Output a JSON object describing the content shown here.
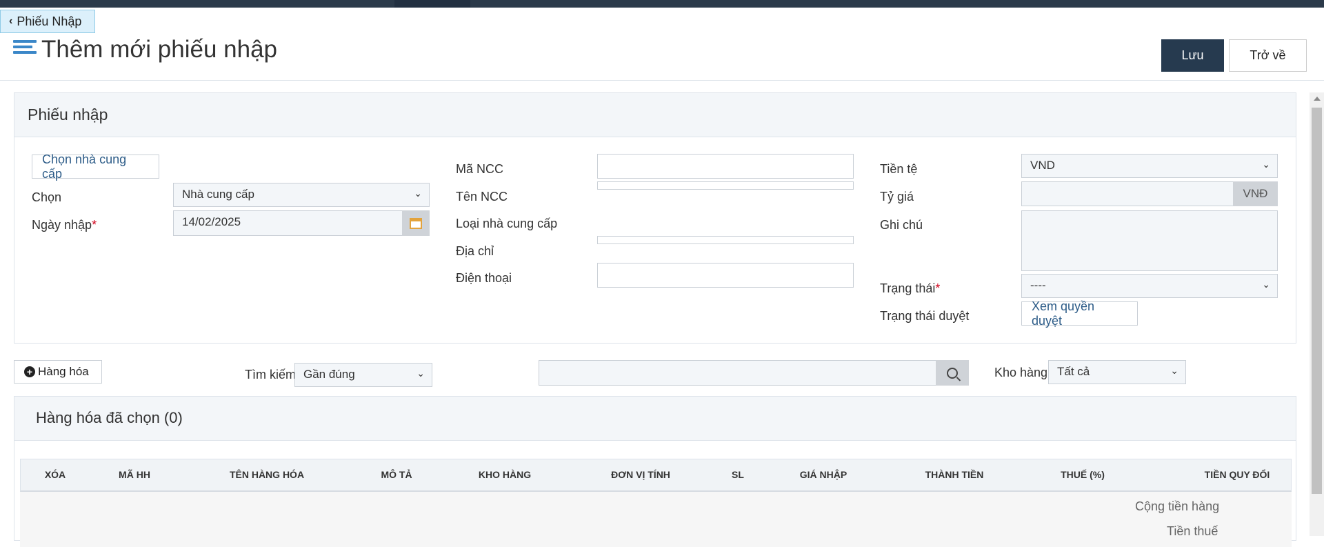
{
  "back_link": {
    "chevron": "‹",
    "label": "Phiếu Nhập"
  },
  "page_title": "Thêm mới phiếu nhập",
  "actions": {
    "save_label": "Lưu",
    "back_label": "Trở về"
  },
  "receipt_panel": {
    "title": "Phiếu nhập",
    "choose_supplier_label": "Chọn nhà cung cấp",
    "choose_label": "Chọn",
    "choose_value": "Nhà cung cấp",
    "date_label": "Ngày nhập",
    "required_mark": "*",
    "date_value": "14/02/2025",
    "supplier_code_label": "Mã NCC",
    "supplier_code_value": "",
    "supplier_name_label": "Tên NCC",
    "supplier_type_label": "Loại nhà cung cấp",
    "address_label": "Địa chỉ",
    "phone_label": "Điện thoại",
    "phone_value": "",
    "currency_label": "Tiền tệ",
    "currency_value": "VND",
    "rate_label": "Tỷ giá",
    "rate_value": "",
    "rate_unit": "VNĐ",
    "note_label": "Ghi chú",
    "note_value": "",
    "status_label": "Trạng thái",
    "status_value": "----",
    "approval_label": "Trạng thái duyệt",
    "approval_button": "Xem quyền duyệt"
  },
  "toolbar": {
    "add_goods_label": "Hàng hóa",
    "search_label": "Tìm kiếm",
    "search_mode": "Gần đúng",
    "search_value": "",
    "warehouse_label": "Kho hàng",
    "warehouse_value": "Tất cả"
  },
  "goods_panel": {
    "title": "Hàng hóa đã chọn (0)",
    "columns": [
      "XÓA",
      "MÃ HH",
      "TÊN HÀNG HÓA",
      "MÔ TẢ",
      "KHO HÀNG",
      "ĐƠN VỊ TÍNH",
      "SL",
      "GIÁ NHẬP",
      "THÀNH TIỀN",
      "THUẾ (%)",
      "TIỀN QUY ĐỔI"
    ],
    "sum_goods_label": "Cộng tiền hàng",
    "sum_tax_label": "Tiền thuế"
  },
  "colors": {
    "primary": "#263a4f",
    "accent_blue": "#3b87c8",
    "link_blue": "#2d5c88",
    "required": "#d0021b"
  }
}
